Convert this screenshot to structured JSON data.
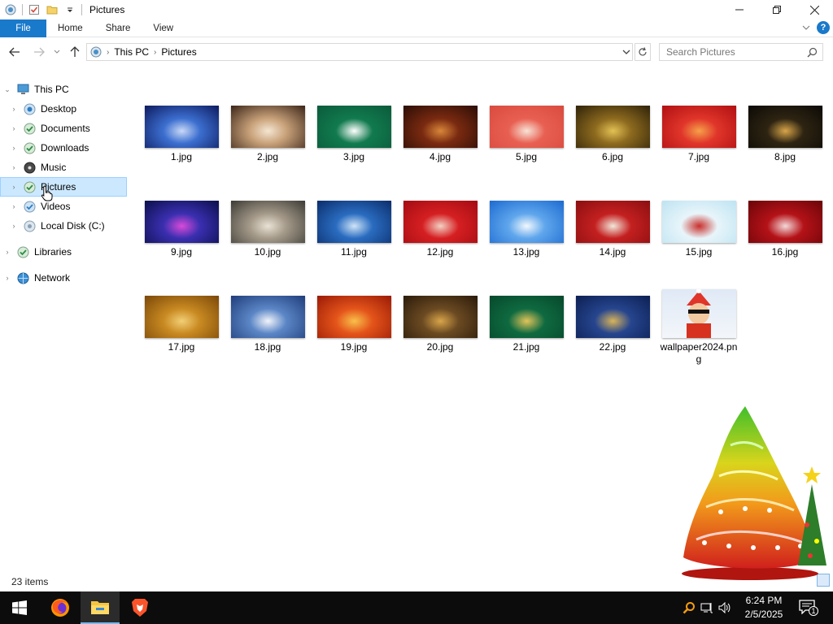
{
  "window": {
    "title": "Pictures",
    "controls": {
      "minimize": "—",
      "maximize": "☐",
      "close": "✕"
    }
  },
  "ribbon": {
    "tabs": [
      "File",
      "Home",
      "Share",
      "View"
    ],
    "help": "?"
  },
  "address": {
    "crumbs": [
      "This PC",
      "Pictures"
    ],
    "search_placeholder": "Search Pictures"
  },
  "nav": {
    "items": [
      {
        "label": "This PC",
        "icon": "pc-icon"
      },
      {
        "label": "Desktop",
        "icon": "desktop-icon"
      },
      {
        "label": "Documents",
        "icon": "documents-icon"
      },
      {
        "label": "Downloads",
        "icon": "downloads-icon"
      },
      {
        "label": "Music",
        "icon": "music-icon"
      },
      {
        "label": "Pictures",
        "icon": "pictures-icon",
        "selected": true
      },
      {
        "label": "Videos",
        "icon": "videos-icon"
      },
      {
        "label": "Local Disk (C:)",
        "icon": "disk-icon"
      },
      {
        "label": "Libraries",
        "icon": "libraries-icon"
      },
      {
        "label": "Network",
        "icon": "network-icon"
      }
    ]
  },
  "files": [
    {
      "name": "1.jpg",
      "colors": [
        "#0d1a5e",
        "#3c6fd0",
        "#c9d9f7"
      ]
    },
    {
      "name": "2.jpg",
      "colors": [
        "#3a2418",
        "#c9a27a",
        "#f4e6d2"
      ]
    },
    {
      "name": "3.jpg",
      "colors": [
        "#0b5a3a",
        "#117a4e",
        "#ffffff"
      ]
    },
    {
      "name": "4.jpg",
      "colors": [
        "#2a0d06",
        "#7a2a10",
        "#d9863a"
      ]
    },
    {
      "name": "5.jpg",
      "colors": [
        "#d94a3e",
        "#e86052",
        "#f7e3d6"
      ]
    },
    {
      "name": "6.jpg",
      "colors": [
        "#2e2209",
        "#8d6a1e",
        "#e3c154"
      ]
    },
    {
      "name": "7.jpg",
      "colors": [
        "#b00f12",
        "#e0352a",
        "#f6a04a"
      ]
    },
    {
      "name": "8.jpg",
      "colors": [
        "#0c0a06",
        "#2e2412",
        "#d8a54a"
      ]
    },
    {
      "name": "9.jpg",
      "colors": [
        "#0a0f4a",
        "#3a2fb0",
        "#d94ad9"
      ]
    },
    {
      "name": "10.jpg",
      "colors": [
        "#3b3a34",
        "#a59a8a",
        "#e9e2d4"
      ]
    },
    {
      "name": "11.jpg",
      "colors": [
        "#0b2d6b",
        "#2a6cc0",
        "#cfe4f7"
      ]
    },
    {
      "name": "12.jpg",
      "colors": [
        "#a30c12",
        "#d51f22",
        "#f3d1c3"
      ]
    },
    {
      "name": "13.jpg",
      "colors": [
        "#1c6ad1",
        "#5fa6ec",
        "#f3f8fd"
      ]
    },
    {
      "name": "14.jpg",
      "colors": [
        "#8a0e10",
        "#c42020",
        "#f2e7da"
      ]
    },
    {
      "name": "15.jpg",
      "colors": [
        "#bde3f2",
        "#e8f5fa",
        "#c9302c"
      ]
    },
    {
      "name": "16.jpg",
      "colors": [
        "#6a0508",
        "#b41218",
        "#f4d8d8"
      ]
    },
    {
      "name": "17.jpg",
      "colors": [
        "#7a4708",
        "#c98a22",
        "#f2cf76"
      ]
    },
    {
      "name": "18.jpg",
      "colors": [
        "#1f3c7a",
        "#5b86c6",
        "#f2f4fa"
      ]
    },
    {
      "name": "19.jpg",
      "colors": [
        "#9a1a06",
        "#e4541a",
        "#f9c04a"
      ]
    },
    {
      "name": "20.jpg",
      "colors": [
        "#2a1a0a",
        "#6b4a22",
        "#d9a54a"
      ]
    },
    {
      "name": "21.jpg",
      "colors": [
        "#06482c",
        "#0f6a40",
        "#e2c45a"
      ]
    },
    {
      "name": "22.jpg",
      "colors": [
        "#0c1f52",
        "#26458e",
        "#d9b45a"
      ]
    },
    {
      "name": "wallpaper2024.png",
      "colors": [
        "#dfe9f6",
        "#f3f6fa",
        "#e0352a"
      ]
    }
  ],
  "status": {
    "items_text": "23 items"
  },
  "taskbar": {
    "time": "6:24 PM",
    "date": "2/5/2025",
    "notification_count": "1",
    "apps": [
      "start-icon",
      "firefox-icon",
      "file-explorer-icon",
      "brave-icon"
    ]
  }
}
